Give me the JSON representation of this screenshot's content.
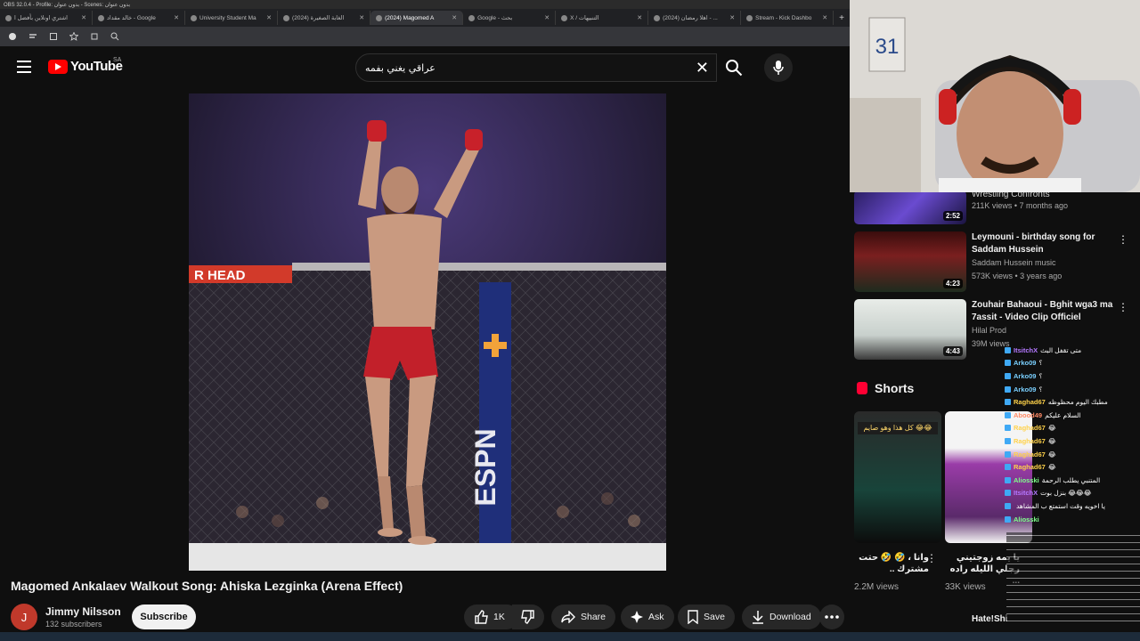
{
  "obs": {
    "title": "OBS 32.0.4 - Profile: بدون عنوان - Scenes: بدون عنوان"
  },
  "browser": {
    "tabs": [
      {
        "label": "اشتري اونلاين بأفضل ا",
        "active": false
      },
      {
        "label": "خالد مقداد - Google",
        "active": false
      },
      {
        "label": "University Student Ma",
        "active": false
      },
      {
        "label": "(2024) الغابة الصغيرة",
        "active": false
      },
      {
        "label": "(2024) Magomed A",
        "active": true
      },
      {
        "label": "Google - بحث",
        "active": false
      },
      {
        "label": "X / التنبيهات",
        "active": false
      },
      {
        "label": "(2024) اهلا رمضان - ...",
        "active": false
      },
      {
        "label": "Stream - Kick Dashbo",
        "active": false
      }
    ]
  },
  "header": {
    "logo": "YouTube",
    "region": "SA",
    "search_value": "عراقي يغني بفمه"
  },
  "video": {
    "title": "Magomed Ankalaev Walkout Song: Ahiska Lezginka (Arena Effect)",
    "banner_text": "R HEAD",
    "pad_text": "ESPN",
    "channel_initial": "J",
    "channel_name": "Jimmy Nilsson",
    "subscribers": "132 subscribers",
    "subscribe_label": "Subscribe",
    "likes": "1K",
    "share_label": "Share",
    "ask_label": "Ask",
    "save_label": "Save",
    "download_label": "Download"
  },
  "sidebar": {
    "recs": [
      {
        "title": "Wrestling Confronts",
        "channel": "",
        "meta": "211K views • 7 months ago",
        "duration": "2:52"
      },
      {
        "title": "Leymouni - birthday song for Saddam Hussein",
        "channel": "Saddam Hussein music",
        "meta": "573K views • 3 years ago",
        "duration": "4:23"
      },
      {
        "title": "Zouhair Bahaoui - Bghit wga3 ma 7assit - Video Clip Officiel",
        "channel": "Hilal Prod",
        "meta": "39M views",
        "duration": "4:43"
      }
    ],
    "shorts_label": "Shorts",
    "shorts": [
      {
        "overlay": "كل هذا وهو صايم 😂😂",
        "title": "وانا ، 🤣 🤣 حتت مشترك ..",
        "views": "2.2M views"
      },
      {
        "overlay": "",
        "title": "يا يمه زوجتيني رجلي الليله راده ...",
        "views": "33K views"
      }
    ],
    "hate_title": "Hate!Shi"
  },
  "chat": [
    {
      "user": "ItsitchX",
      "msg": "متى تقفل البث",
      "color": "#b478ff"
    },
    {
      "user": "Arko09",
      "msg": "؟",
      "color": "#7ad0ff"
    },
    {
      "user": "Arko09",
      "msg": "؟",
      "color": "#7ad0ff"
    },
    {
      "user": "Arko09",
      "msg": "؟",
      "color": "#7ad0ff"
    },
    {
      "user": "Raghad67",
      "msg": "مطبك اليوم محظوظه",
      "color": "#ffd24a"
    },
    {
      "user": "Abood49",
      "msg": "السلام عليكم",
      "color": "#ff8a65"
    },
    {
      "user": "Raghad67",
      "msg": "😂",
      "color": "#ffd24a"
    },
    {
      "user": "Raghad67",
      "msg": "😂",
      "color": "#ffd24a"
    },
    {
      "user": "Raghad67",
      "msg": "😂",
      "color": "#ffd24a"
    },
    {
      "user": "Raghad67",
      "msg": "😂",
      "color": "#ffd24a"
    },
    {
      "user": "Aliosski",
      "msg": "المتنبي يطلب الرحمة",
      "color": "#7dff8a"
    },
    {
      "user": "ItsitchX",
      "msg": "بنزل بوت 😂😂😂",
      "color": "#b478ff"
    },
    {
      "user": "",
      "msg": "يا اخويه وقت استمتع ب المشاهد",
      "color": "#ffffff"
    },
    {
      "user": "Aliosski",
      "msg": "",
      "color": "#7dff8a"
    }
  ],
  "colors": {
    "accent": "#ff0000",
    "bg": "#0f0f0f",
    "pill": "#272727"
  }
}
